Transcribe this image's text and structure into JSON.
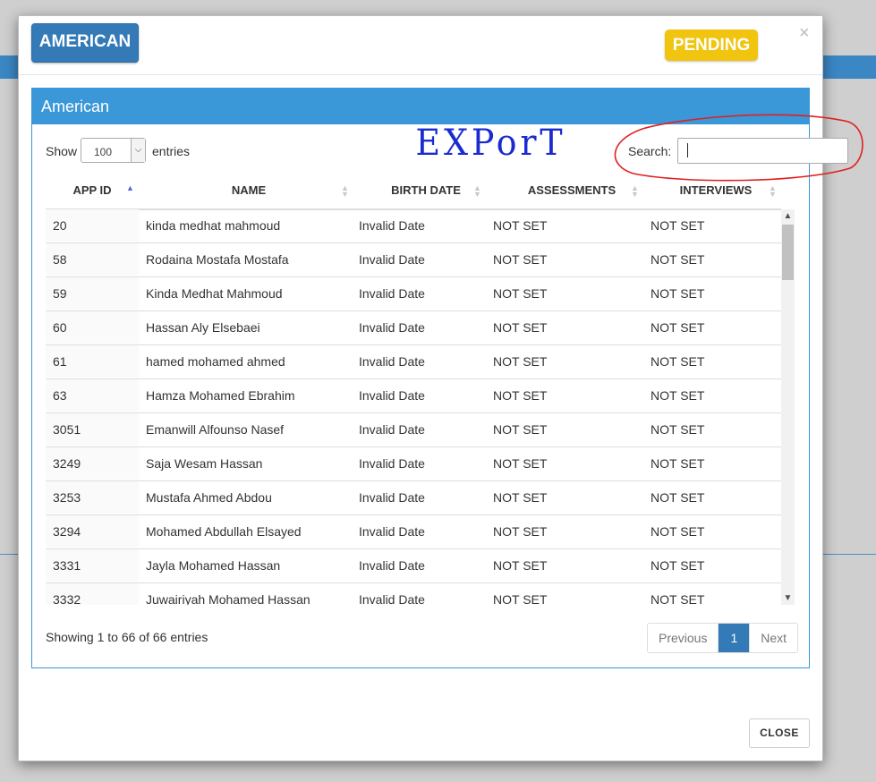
{
  "modal": {
    "category_button": "AMERICAN",
    "status_badge": "PENDING",
    "close_x": "×",
    "close_button": "CLOSE",
    "colors": {
      "primary": "#337ab7",
      "panel": "#3a97d8",
      "pending": "#f1c40f",
      "annotation_red": "#e02020",
      "annotation_blue": "#1a2bcf"
    }
  },
  "panel": {
    "title": "American",
    "length": {
      "show_label": "Show",
      "value": "100",
      "entries_label": "entries"
    },
    "annotation_text": "EXPorT",
    "search": {
      "label": "Search:",
      "value": ""
    },
    "columns": [
      "APP ID",
      "NAME",
      "BIRTH DATE",
      "ASSESSMENTS",
      "INTERVIEWS"
    ],
    "rows": [
      {
        "id": "20",
        "name": "kinda medhat mahmoud",
        "birth": "Invalid Date",
        "assess": "NOT SET",
        "interviews": "NOT SET"
      },
      {
        "id": "58",
        "name": "Rodaina Mostafa Mostafa",
        "birth": "Invalid Date",
        "assess": "NOT SET",
        "interviews": "NOT SET"
      },
      {
        "id": "59",
        "name": "Kinda Medhat Mahmoud",
        "birth": "Invalid Date",
        "assess": "NOT SET",
        "interviews": "NOT SET"
      },
      {
        "id": "60",
        "name": "Hassan Aly Elsebaei",
        "birth": "Invalid Date",
        "assess": "NOT SET",
        "interviews": "NOT SET"
      },
      {
        "id": "61",
        "name": "hamed mohamed ahmed",
        "birth": "Invalid Date",
        "assess": "NOT SET",
        "interviews": "NOT SET"
      },
      {
        "id": "63",
        "name": "Hamza Mohamed Ebrahim",
        "birth": "Invalid Date",
        "assess": "NOT SET",
        "interviews": "NOT SET"
      },
      {
        "id": "3051",
        "name": "Emanwill Alfounso Nasef",
        "birth": "Invalid Date",
        "assess": "NOT SET",
        "interviews": "NOT SET"
      },
      {
        "id": "3249",
        "name": "Saja Wesam Hassan",
        "birth": "Invalid Date",
        "assess": "NOT SET",
        "interviews": "NOT SET"
      },
      {
        "id": "3253",
        "name": "Mustafa Ahmed Abdou",
        "birth": "Invalid Date",
        "assess": "NOT SET",
        "interviews": "NOT SET"
      },
      {
        "id": "3294",
        "name": "Mohamed Abdullah Elsayed",
        "birth": "Invalid Date",
        "assess": "NOT SET",
        "interviews": "NOT SET"
      },
      {
        "id": "3331",
        "name": "Jayla Mohamed Hassan",
        "birth": "Invalid Date",
        "assess": "NOT SET",
        "interviews": "NOT SET"
      },
      {
        "id": "3332",
        "name": "Juwairiyah Mohamed Hassan",
        "birth": "Invalid Date",
        "assess": "NOT SET",
        "interviews": "NOT SET"
      }
    ],
    "info": "Showing 1 to 66 of 66 entries",
    "pagination": {
      "previous": "Previous",
      "current": "1",
      "next": "Next"
    }
  }
}
